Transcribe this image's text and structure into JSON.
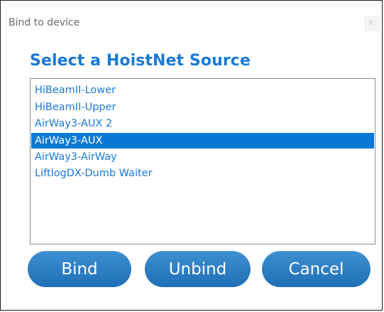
{
  "window": {
    "title": "Bind to device",
    "close_glyph": "x"
  },
  "heading": "Select a HoistNet Source",
  "list": {
    "selected_index": 3,
    "items": [
      {
        "label": "HiBeamII-Lower"
      },
      {
        "label": "HiBeamII-Upper"
      },
      {
        "label": "AirWay3-AUX 2"
      },
      {
        "label": "AirWay3-AUX"
      },
      {
        "label": "AirWay3-AirWay"
      },
      {
        "label": "LiftlogDX-Dumb Waiter"
      }
    ]
  },
  "buttons": {
    "bind": "Bind",
    "unbind": "Unbind",
    "cancel": "Cancel"
  },
  "colors": {
    "accent": "#1a79d6",
    "selection": "#0a79d6",
    "button": "#2a7cc2"
  }
}
